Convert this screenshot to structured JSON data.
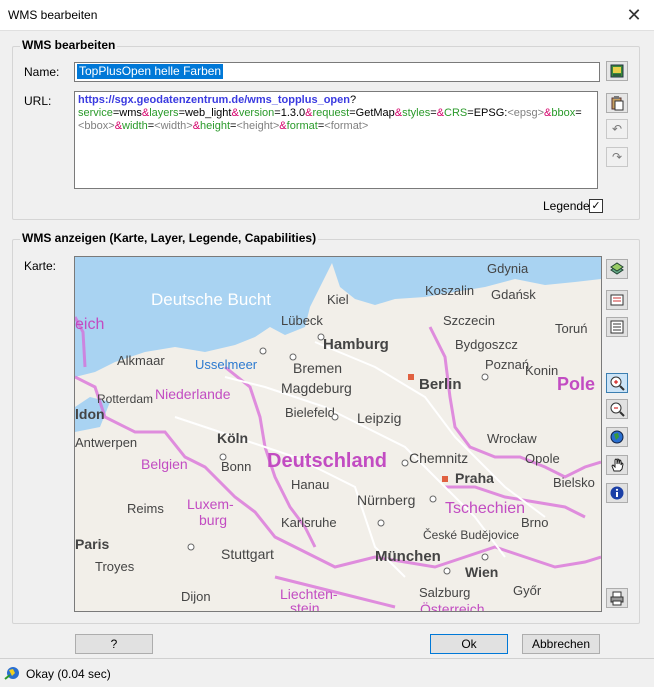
{
  "window": {
    "title": "WMS bearbeiten",
    "close_glyph": "✕"
  },
  "edit_group": {
    "title": "WMS bearbeiten",
    "name_label": "Name:",
    "name_value": "TopPlusOpen helle Farben",
    "url_label": "URL:",
    "url_segments": [
      {
        "t": "https://sgx.geodatenzentrum.de/wms_topplus_open",
        "k": "base"
      },
      {
        "t": "?",
        "k": "val"
      },
      {
        "t": "service",
        "k": "key"
      },
      {
        "t": "=wms",
        "k": "val"
      },
      {
        "t": "&",
        "k": "amp"
      },
      {
        "t": "layers",
        "k": "key"
      },
      {
        "t": "=web_light",
        "k": "val"
      },
      {
        "t": "&",
        "k": "amp"
      },
      {
        "t": "version",
        "k": "key"
      },
      {
        "t": "=1.3.0",
        "k": "val"
      },
      {
        "t": "&",
        "k": "amp"
      },
      {
        "t": "request",
        "k": "key"
      },
      {
        "t": "=GetMap",
        "k": "val"
      },
      {
        "t": "&",
        "k": "amp"
      },
      {
        "t": "styles",
        "k": "key"
      },
      {
        "t": "=",
        "k": "val"
      },
      {
        "t": "&",
        "k": "amp"
      },
      {
        "t": "CRS",
        "k": "key"
      },
      {
        "t": "=EPSG:",
        "k": "val"
      },
      {
        "t": "<epsg>",
        "k": "ph"
      },
      {
        "t": "&",
        "k": "amp"
      },
      {
        "t": "bbox",
        "k": "key"
      },
      {
        "t": "=",
        "k": "val"
      },
      {
        "t": "<bbox>",
        "k": "ph"
      },
      {
        "t": "&",
        "k": "amp"
      },
      {
        "t": "width",
        "k": "key"
      },
      {
        "t": "=",
        "k": "val"
      },
      {
        "t": "<width>",
        "k": "ph"
      },
      {
        "t": "&",
        "k": "amp"
      },
      {
        "t": "height",
        "k": "key"
      },
      {
        "t": "=",
        "k": "val"
      },
      {
        "t": "<height>",
        "k": "ph"
      },
      {
        "t": "&",
        "k": "amp"
      },
      {
        "t": "format",
        "k": "key"
      },
      {
        "t": "=",
        "k": "val"
      },
      {
        "t": "<format>",
        "k": "ph"
      }
    ],
    "legend_label": "Legende",
    "legend_checked": "✓"
  },
  "show_group": {
    "title": "WMS anzeigen (Karte, Layer, Legende, Capabilities)",
    "map_label": "Karte:"
  },
  "map": {
    "sea_labels": [
      "Deutsche Bucht"
    ],
    "country_labels": [
      "Deutschland",
      "Niederlande",
      "Belgien",
      "Luxem-",
      "burg",
      "Tschechien",
      "Liechten-",
      "stein",
      "Österreich",
      "Pole",
      "eich",
      "Rotterdam",
      "Usselmeer"
    ],
    "cities": [
      "Gdynia",
      "Kiel",
      "Koszalin",
      "Gdańsk",
      "Lübeck",
      "Szczecin",
      "Toruń",
      "Hamburg",
      "Bydgoszcz",
      "Alkmaar",
      "Bremen",
      "Poznań",
      "Konin",
      "Magdeburg",
      "Berlin",
      "Bielefeld",
      "Leipzig",
      "Wrocław",
      "Antwerpen",
      "Köln",
      "Opole",
      "Bonn",
      "Chemnitz",
      "Praha",
      "Bielsko",
      "Hanau",
      "Nürnberg",
      "Reims",
      "Brno",
      "Karlsruhe",
      "České Budějovice",
      "Paris",
      "Stuttgart",
      "München",
      "Wien",
      "Troyes",
      "Salzburg",
      "Győr",
      "Dijon",
      "ldon"
    ]
  },
  "buttons": {
    "help": "?",
    "ok": "Ok",
    "cancel": "Abbrechen"
  },
  "status": {
    "text": "Okay (0.04 sec)"
  },
  "colors": {
    "accent": "#0078d7",
    "sea": "#a9d3f2",
    "land": "#f2efe9",
    "border": "#d86bd8"
  }
}
